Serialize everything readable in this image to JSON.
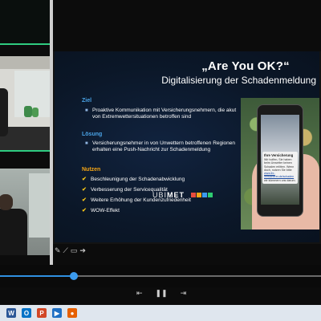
{
  "slide": {
    "title": "„Are You OK?“",
    "subtitle": "Digitalisierung der Schadenmeldung",
    "sections": {
      "ziel": {
        "heading": "Ziel",
        "bullets": [
          "Proaktive Kommunikation mit Versicherungsnehmern, die akut von Extremwettersituationen betroffen sind"
        ]
      },
      "loesung": {
        "heading": "Lösung",
        "bullets": [
          "Versicherungsnehmer in von Unwettern betroffenen Regionen erhalten eine Push-Nachricht zur Schadenmeldung"
        ]
      },
      "nutzen": {
        "heading": "Nutzen",
        "checks": [
          "Beschleunigung der Schadenabwicklung",
          "Verbesserung der Servicequalität",
          "Weitere Erhöhung der Kundenzufriedenheit",
          "WOW-Effekt"
        ]
      }
    },
    "phone_notification": {
      "title": "Ihre Versicherung",
      "body_start": "Wir hoffen, Sie haben beim Unwetter keinen Schaden erlitten. Wenn doch, nutzen Sie bitte",
      "link": "www.ihr-versicherer.de/schaden",
      "body_end": "wir kümmern uns darum."
    },
    "brand": {
      "name_light": "UBI",
      "name_bold": "MET",
      "dot_colors": [
        "#e84c3d",
        "#f5a515",
        "#3b9bef",
        "#2ecc71"
      ]
    }
  },
  "player": {
    "progress": 0.23
  },
  "icons": {
    "annotation_tools": [
      "pointer-icon",
      "pen-icon",
      "rectangle-icon",
      "arrow-icon"
    ],
    "controls": [
      "back-icon",
      "pause-icon",
      "forward-icon"
    ],
    "taskbar": [
      {
        "name": "word-icon",
        "label": "W",
        "color": "#2b5797"
      },
      {
        "name": "outlook-icon",
        "label": "O",
        "color": "#0072c6"
      },
      {
        "name": "powerpoint-icon",
        "label": "P",
        "color": "#d24726"
      },
      {
        "name": "player-app-icon",
        "label": "▶",
        "color": "#1e6fc4"
      },
      {
        "name": "firefox-icon",
        "label": "●",
        "color": "#e66000"
      }
    ]
  },
  "colors": {
    "accent_green": "#2fcb80",
    "slide_blue_heading": "#4aa3e6",
    "slide_orange_heading": "#f5a515",
    "seek_blue": "#3b9bef"
  }
}
